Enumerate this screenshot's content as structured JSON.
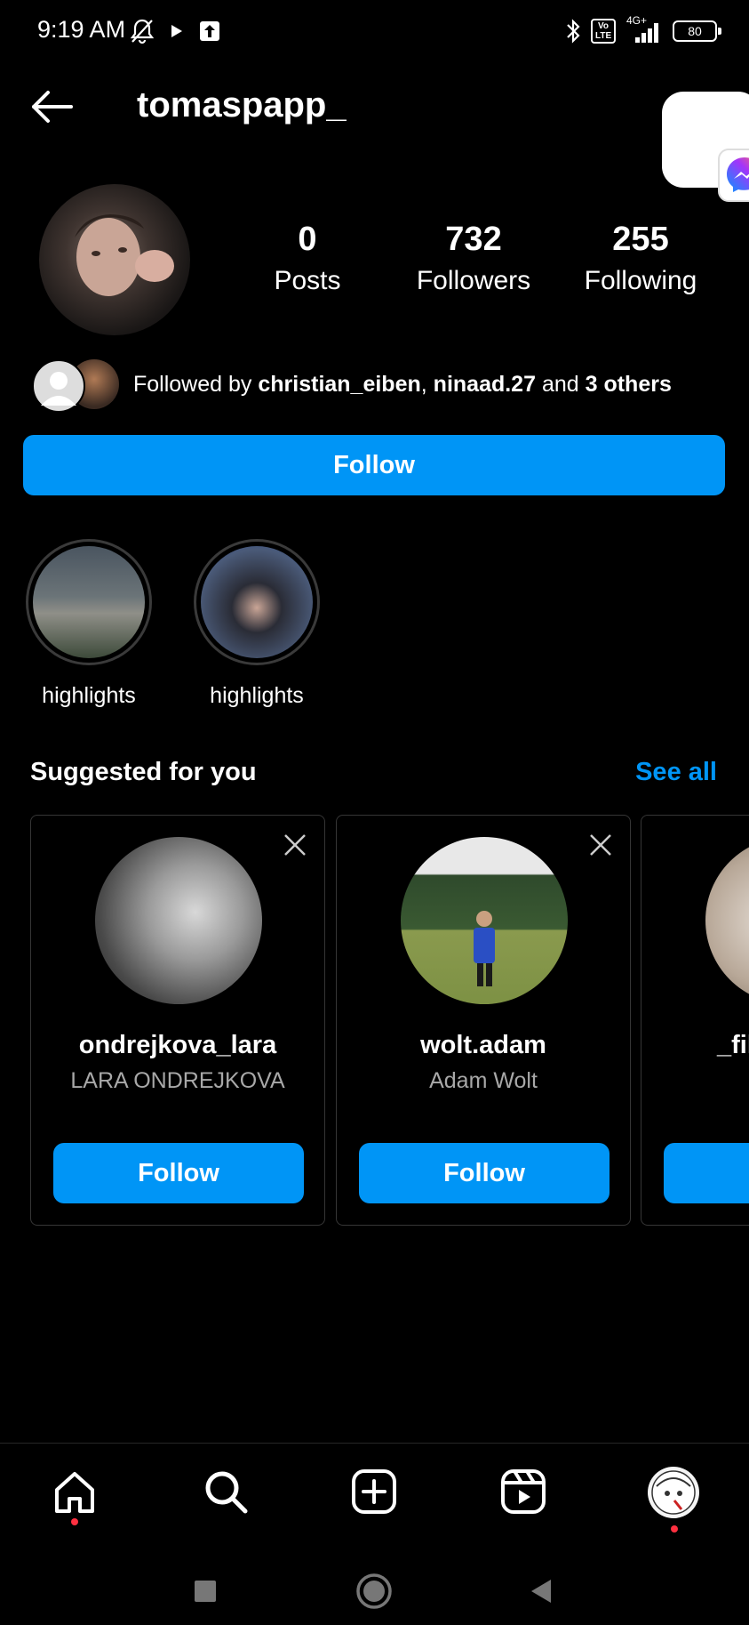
{
  "status_bar": {
    "time": "9:19 AM",
    "network": "4G+",
    "volte": "Vo LTE",
    "battery": "80"
  },
  "header": {
    "username": "tomaspapp_"
  },
  "profile": {
    "stats": [
      {
        "value": "0",
        "label": "Posts"
      },
      {
        "value": "732",
        "label": "Followers"
      },
      {
        "value": "255",
        "label": "Following"
      }
    ],
    "followed_by": {
      "prefix": "Followed by ",
      "user1": "christian_eiben",
      "sep": ", ",
      "user2": "ninaad.27",
      "mid": " and ",
      "others": "3 others"
    },
    "follow_label": "Follow"
  },
  "highlights": [
    {
      "label": "highlights"
    },
    {
      "label": "highlights"
    }
  ],
  "suggested": {
    "title": "Suggested for you",
    "see_all": "See all",
    "cards": [
      {
        "username": "ondrejkova_lara",
        "fullname": "LARA ONDREJKOVA",
        "button": "Follow"
      },
      {
        "username": "wolt.adam",
        "fullname": "Adam Wolt",
        "button": "Follow"
      },
      {
        "username": "_fil",
        "fullname": "",
        "button": ""
      }
    ]
  },
  "nav": {
    "items": [
      "home-icon",
      "search-icon",
      "create-icon",
      "reels-icon",
      "profile-avatar"
    ]
  },
  "colors": {
    "accent": "#0095f6",
    "background": "#000000",
    "notification": "#ff3040"
  }
}
